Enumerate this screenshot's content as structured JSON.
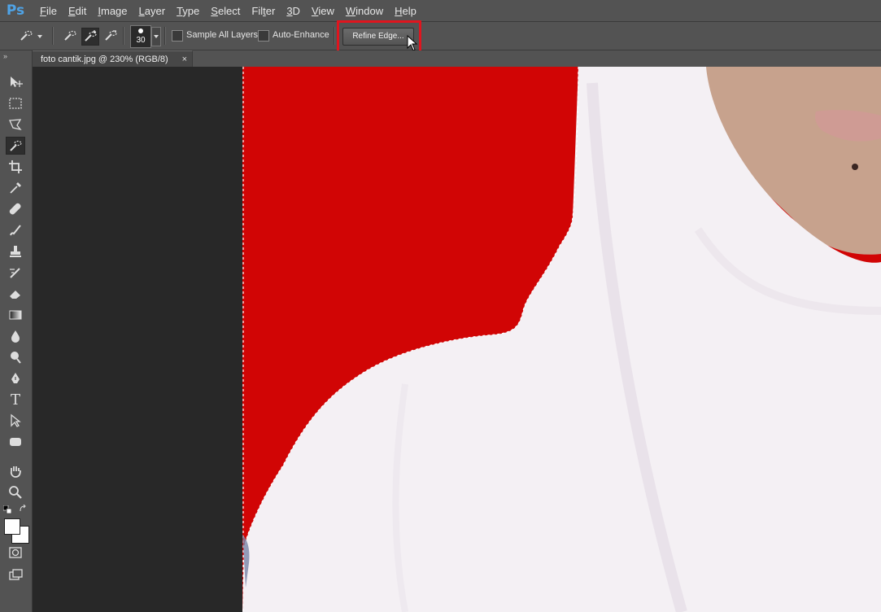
{
  "app": {
    "logo": "Ps"
  },
  "menu": [
    {
      "label": "File",
      "key": "F",
      "rest": "ile"
    },
    {
      "label": "Edit",
      "key": "E",
      "rest": "dit"
    },
    {
      "label": "Image",
      "key": "I",
      "rest": "mage"
    },
    {
      "label": "Layer",
      "key": "L",
      "rest": "ayer"
    },
    {
      "label": "Type",
      "key": "T",
      "rest": "ype"
    },
    {
      "label": "Select",
      "key": "S",
      "rest": "elect"
    },
    {
      "label": "Filter",
      "key": "T",
      "pre": "Fil",
      "rest": "er"
    },
    {
      "label": "3D",
      "key": "3",
      "rest": "D"
    },
    {
      "label": "View",
      "key": "V",
      "rest": "iew"
    },
    {
      "label": "Window",
      "key": "W",
      "rest": "indow"
    },
    {
      "label": "Help",
      "key": "H",
      "rest": "elp"
    }
  ],
  "options": {
    "brush_size": "30",
    "sample_all_layers": "Sample All Layers",
    "auto_enhance": "Auto-Enhance",
    "refine_edge": "Refine Edge..."
  },
  "document": {
    "tab_label": "foto cantik.jpg @ 230% (RGB/8)",
    "close_glyph": "×"
  },
  "toolbar": {
    "collapse_glyph": "»",
    "tools": [
      "move-tool-icon",
      "marquee-tool-icon",
      "lasso-tool-icon",
      "quick-selection-tool-icon",
      "crop-tool-icon",
      "eyedropper-tool-icon",
      "healing-brush-tool-icon",
      "brush-tool-icon",
      "clone-stamp-tool-icon",
      "history-brush-tool-icon",
      "eraser-tool-icon",
      "gradient-tool-icon",
      "blur-tool-icon",
      "dodge-tool-icon",
      "pen-tool-icon",
      "type-tool-icon",
      "path-selection-tool-icon",
      "shape-tool-icon",
      "hand-tool-icon",
      "zoom-tool-icon"
    ],
    "active_tool": "quick-selection-tool-icon",
    "type_glyph": "T"
  },
  "colors": {
    "background_red": "#d10505",
    "highlight_box": "#e0151e",
    "foreground": "#ffffff",
    "background": "#ffffff"
  }
}
